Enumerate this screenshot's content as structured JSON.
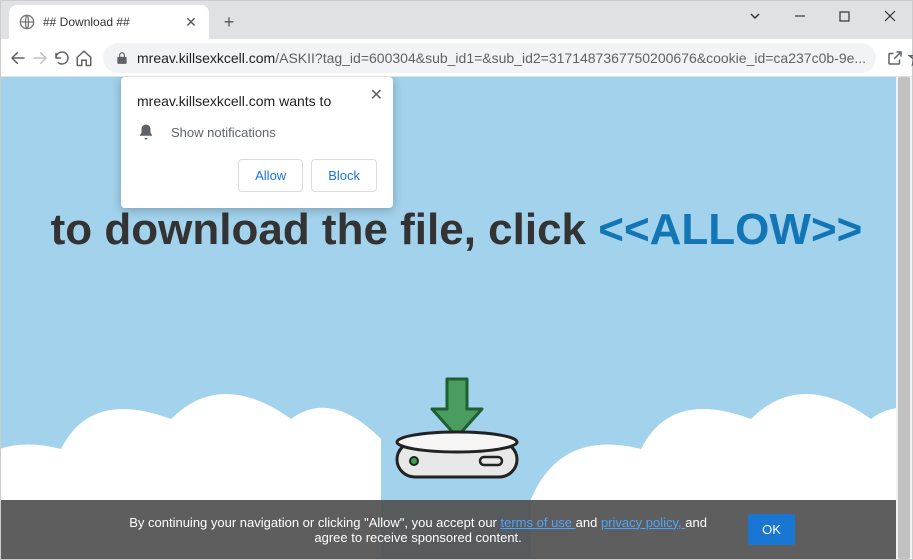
{
  "tab": {
    "title": "## Download ##"
  },
  "url": {
    "host": "mreav.killsexkcell.com",
    "path": "/ASKII?tag_id=600304&sub_id1=&sub_id2=3171487367750200676&cookie_id=ca237c0b-9e..."
  },
  "notification_popup": {
    "title": "mreav.killsexkcell.com wants to",
    "permission_label": "Show notifications",
    "allow_label": "Allow",
    "block_label": "Block"
  },
  "page": {
    "headline_part1": "to download the file, click ",
    "headline_part2": "<<ALLOW>>"
  },
  "cookie_bar": {
    "text_1": "By continuing your navigation or clicking \"Allow\", you accept our ",
    "terms_link": "terms of use ",
    "text_2": "and ",
    "privacy_link": "privacy policy, ",
    "text_3": "and agree to receive sponsored content.",
    "ok_label": "OK"
  }
}
